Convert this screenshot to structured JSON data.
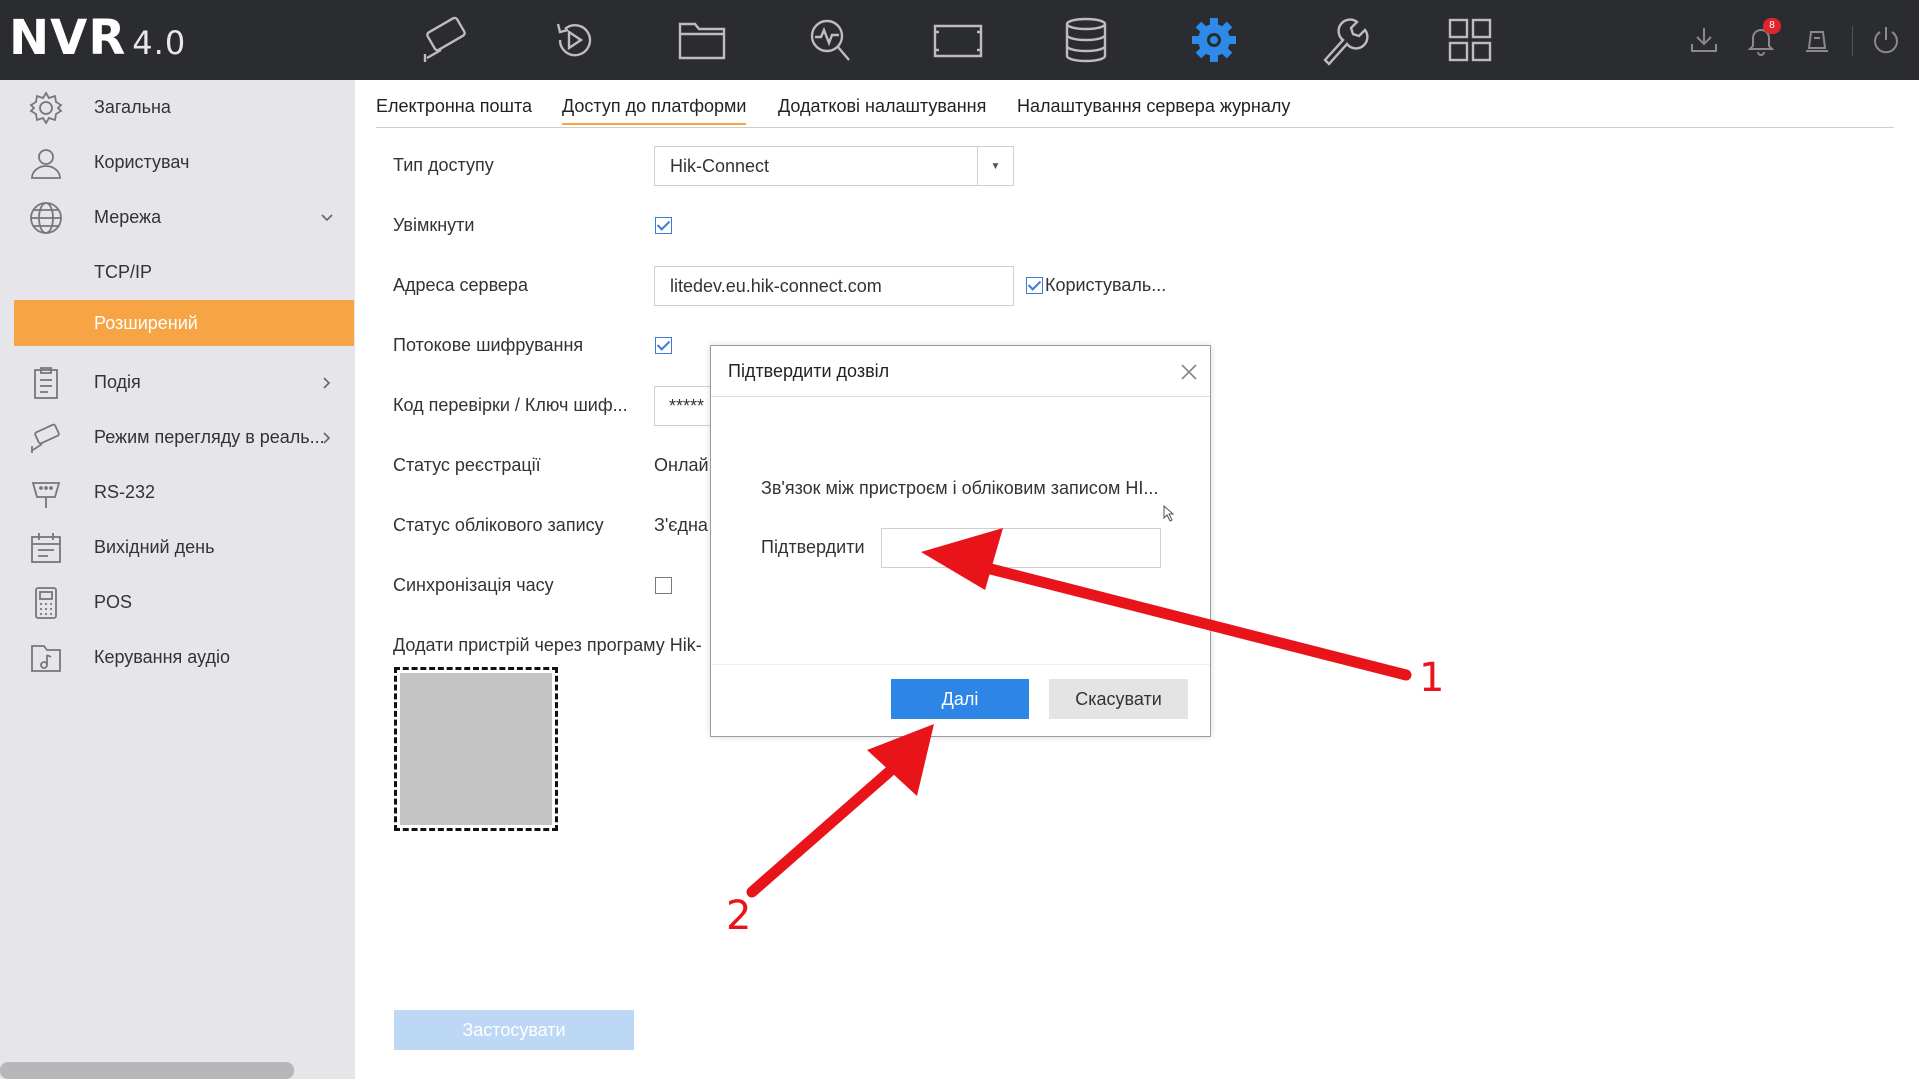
{
  "app": {
    "logo": "NVR",
    "version": "4.0",
    "notification_count": "8"
  },
  "top_nav": [
    "live-view-camera-icon",
    "playback-icon",
    "file-folder-icon",
    "smart-search-icon",
    "video-wall-icon",
    "storage-database-icon",
    "configuration-gear-icon",
    "maintenance-wrench-icon",
    "layout-grid-icon"
  ],
  "top_right": [
    "download-icon",
    "bell-icon",
    "alarm-icon",
    "power-icon"
  ],
  "colors": {
    "accent": "#f7a445",
    "primary_button": "#2d86e6",
    "topbar": "#2b2c30",
    "sidebar": "#e6e6ea",
    "annotation": "#e8141a"
  },
  "sidebar": {
    "items": [
      {
        "label": "Загальна",
        "icon": "gear-icon"
      },
      {
        "label": "Користувач",
        "icon": "user-icon"
      },
      {
        "label": "Мережа",
        "icon": "globe-icon"
      },
      {
        "label": "TCP/IP"
      },
      {
        "label": "Розширений"
      },
      {
        "label": "Подія",
        "icon": "clipboard-icon"
      },
      {
        "label": "Режим перегляду в реаль...",
        "icon": "camera-icon"
      },
      {
        "label": "RS-232",
        "icon": "rs232-icon"
      },
      {
        "label": "Вихідний день",
        "icon": "calendar-icon"
      },
      {
        "label": "POS",
        "icon": "pos-terminal-icon"
      },
      {
        "label": "Керування аудіо",
        "icon": "audio-icon"
      }
    ]
  },
  "tabs": [
    "Електронна пошта",
    "Доступ до платформи",
    "Додаткові налаштування",
    "Налаштування сервера журналу"
  ],
  "form": {
    "access_type_label": "Тип доступу",
    "access_type_value": "Hik-Connect",
    "enable_label": "Увімкнути",
    "server_address_label": "Адреса сервера",
    "server_address_value": "litedev.eu.hik-connect.com",
    "custom_checkbox_label": "Користуваль...",
    "stream_encryption_label": "Потокове шифрування",
    "verification_code_label": "Код перевірки / Ключ шиф...",
    "verification_code_value": "*****",
    "registration_status_label": "Статус реєстрації",
    "registration_status_value": "Онлай",
    "account_status_label": "Статус облікового запису",
    "account_status_value": "З'єдна",
    "time_sync_label": "Синхронізація часу",
    "add_device_label": "Додати пристрій через програму Hik-",
    "apply_button": "Застосувати"
  },
  "dialog": {
    "title": "Підтвердити дозвіл",
    "message": "Зв'язок між пристроєм і обліковим записом HI...",
    "confirm_label": "Підтвердити",
    "confirm_value": "",
    "next_button": "Далі",
    "cancel_button": "Скасувати"
  },
  "annotations": {
    "marker_1": "1",
    "marker_2": "2"
  }
}
